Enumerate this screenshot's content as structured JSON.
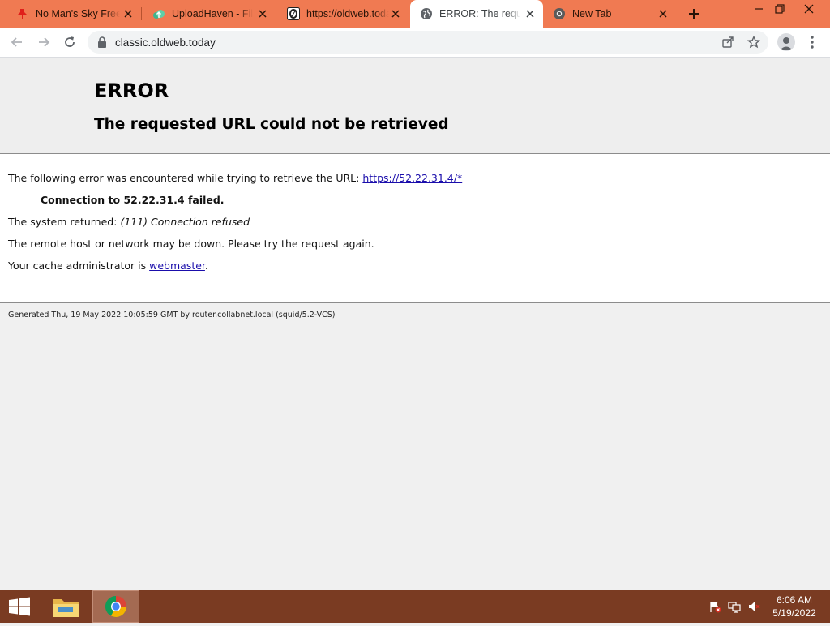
{
  "browser": {
    "tabs": [
      {
        "title": "No Man's Sky Free",
        "favicon": "red-pin-icon",
        "active": false
      },
      {
        "title": "UploadHaven - File",
        "favicon": "cloud-upload-icon",
        "active": false
      },
      {
        "title": "https://oldweb.today",
        "favicon": "oldweb-o-icon",
        "active": false
      },
      {
        "title": "ERROR: The request",
        "favicon": "globe-icon",
        "active": true
      },
      {
        "title": "New Tab",
        "favicon": "chrome-icon",
        "active": false
      }
    ],
    "address": "classic.oldweb.today",
    "colors": {
      "tab_strip": "#f07a52",
      "active_tab": "#ffffff",
      "toolbar": "#ffffff"
    }
  },
  "error_page": {
    "heading": "ERROR",
    "subheading": "The requested URL could not be retrieved",
    "intro": "The following error was encountered while trying to retrieve the URL:",
    "url_link": "https://52.22.31.4/*",
    "failure": "Connection to 52.22.31.4 failed.",
    "system_returned_label": "The system returned:",
    "system_returned_value": "(111) Connection refused",
    "advice": "The remote host or network may be down. Please try the request again.",
    "admin_label": "Your cache administrator is",
    "admin_link": "webmaster",
    "admin_suffix": ".",
    "footer": "Generated Thu, 19 May 2022 10:05:59 GMT by router.collabnet.local (squid/5.2-VCS)"
  },
  "taskbar": {
    "apps": [
      {
        "name": "file-explorer-icon",
        "active": false
      },
      {
        "name": "chrome-icon",
        "active": true
      }
    ],
    "time": "6:06 AM",
    "date": "5/19/2022",
    "color": "#7a3b22"
  }
}
